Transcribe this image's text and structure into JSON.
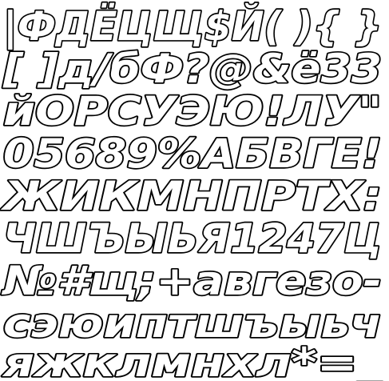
{
  "specimen": {
    "rows": [
      "|ФДЁЦЩ$Й( ){ }",
      "[ ]д/бФ?@&ё33",
      "йОРСУЭЮ!ЛУ\"",
      "05689%АБВГЕ!",
      "ЖИКМНПРТХ:",
      "ЧШЪЫЬЯ1247Ц",
      "№#щ;+авгезо-",
      "сэюиптшъыьч",
      "яжклмнхл*=_"
    ],
    "colors": {
      "fill": "#ffffff",
      "outline": "#000000",
      "background": "#ffffff"
    }
  }
}
